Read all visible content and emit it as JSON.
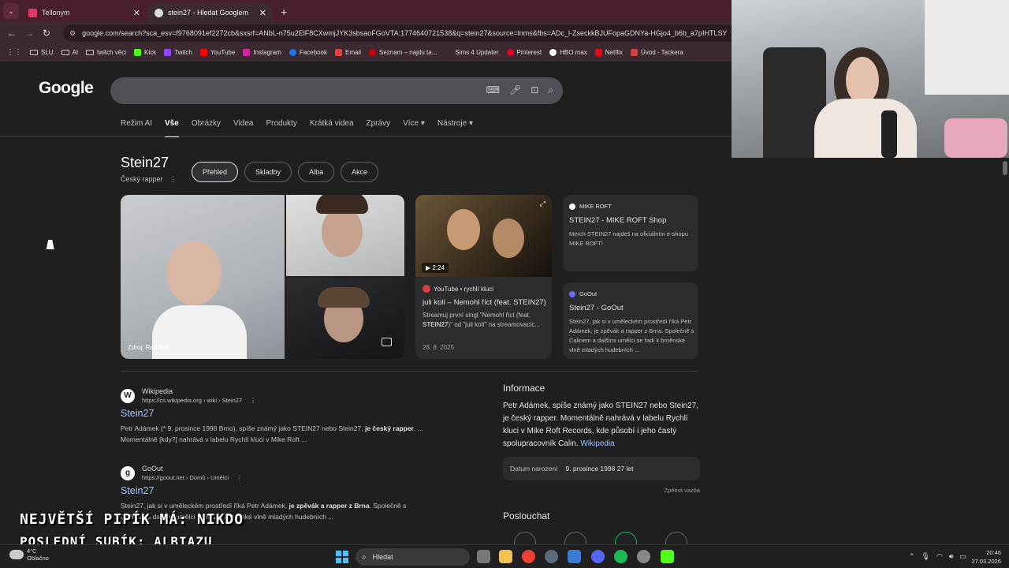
{
  "browser": {
    "tabs": [
      {
        "label": "Tellonym",
        "active": false
      },
      {
        "label": "stein27 - Hledat Googlem",
        "active": true
      }
    ],
    "url": "google.com/search?sca_esv=f9768091ef2272cb&sxsrf=ANbL-n75u2ElF8CXwmjJYK3sbsaoFGoVTA:1774640721538&q=stein27&source=lnms&fbs=ADc_l-ZseckkBJUFopaGDNYa-HGjo4_b6b_a7pIHTLSY",
    "bookmarks": [
      "SLU",
      "AI",
      "twitch věci",
      "Kick",
      "Twitch",
      "YouTube",
      "Instagram",
      "Facebook",
      "Email",
      "Seznam – najdu ta...",
      "Sims 4 Updater",
      "Pinterest",
      "HBO max",
      "Netflix",
      "Úvod - Tackera"
    ]
  },
  "google": {
    "logo": "Google",
    "tabs": [
      "Režim AI",
      "Vše",
      "Obrázky",
      "Videa",
      "Produkty",
      "Krátká videa",
      "Zprávy",
      "Více",
      "Nástroje"
    ],
    "active_tab": "Vše"
  },
  "entity": {
    "name": "Stein27",
    "subtitle": "Český rapper",
    "chips": [
      "Přehled",
      "Skladby",
      "Alba",
      "Akce"
    ],
    "image_source": "Zdroj: Red Bull"
  },
  "video": {
    "duration": "2:24",
    "source": "YouTube • rychlí kluci",
    "title": "juli kolí – Nemohl říct (feat. STEIN27)",
    "desc_pre": "Streamuj první singl \"Nemohl říct (feat. ",
    "desc_bold": "STEIN27",
    "desc_post": ")\" od \"juli kolí\" na streamovacíc...",
    "date": "28. 8. 2025"
  },
  "cards": [
    {
      "source": "MIKE ROFT",
      "title": "STEIN27 - MIKE ROFT Shop",
      "desc": "Merch STEIN27 najdeš na oficiálním e-shopu MIKE ROFT!"
    },
    {
      "source": "GoOut",
      "title": "Stein27 - GoOut",
      "desc": "Stein27, jak si v uměleckém prostředí říká Petr Adámek, je zpěvák a rapper z Brna. Společně s Calinem a dalšími umělci se řadí k brněnské vlně mladých hudebních ..."
    }
  ],
  "results": [
    {
      "favicon": "W",
      "site": "Wikipedia",
      "url": "https://cs.wikipedia.org › wiki › Stein27",
      "title": "Stein27",
      "s1": "Petr Adámek (* 9. prosince 1998 Brno), spíše známý jako STEIN27 nebo Stein27, ",
      "s1b": "je český rapper",
      "s1e": ". ...",
      "s2": "Momentálně [kdy?] nahrává v labelu Rychlí kluci v Mike Roft ..."
    },
    {
      "favicon": "g",
      "site": "GoOut",
      "url": "https://goout.net › Domů › Umělci",
      "title": "Stein27",
      "s1": "Stein27, jak si v uměleckém prostředí říká Petr Adámek, ",
      "s1b": "je zpěvák a rapper z Brna",
      "s1e": ". Společně s",
      "s2": "Calinem a dalšími umělci se řadí k brněnské vlně mladých hudebních ..."
    }
  ],
  "info": {
    "heading": "Informace",
    "text": "Petr Adámek, spíše známý jako STEIN27 nebo Stein27, je český rapper. Momentálně nahrává v labelu Rychlí kluci v Mike Roft Records, kde působí i jeho častý spolupracovník Calin.",
    "link": "Wikipedia",
    "birth_label": "Datum narození",
    "birth_value": "9. prosince 1998 27 let",
    "feedback": "Zpětná vazba",
    "listen": "Poslouchat"
  },
  "overlay": {
    "line1": "NEJVĚTŠÍ PIPÍK MÁ: NIKDO",
    "line2": "POSLEDNÍ SUBÍK: ALBIAZU"
  },
  "taskbar": {
    "temp": "4°C",
    "weather": "Oblačno",
    "search": "Hledat",
    "time": "20:46",
    "date": "27.03.2026"
  },
  "colors": {
    "tabbar": "#4a1f2c",
    "link": "#99c3ff",
    "accent": "#4cc2ff"
  }
}
